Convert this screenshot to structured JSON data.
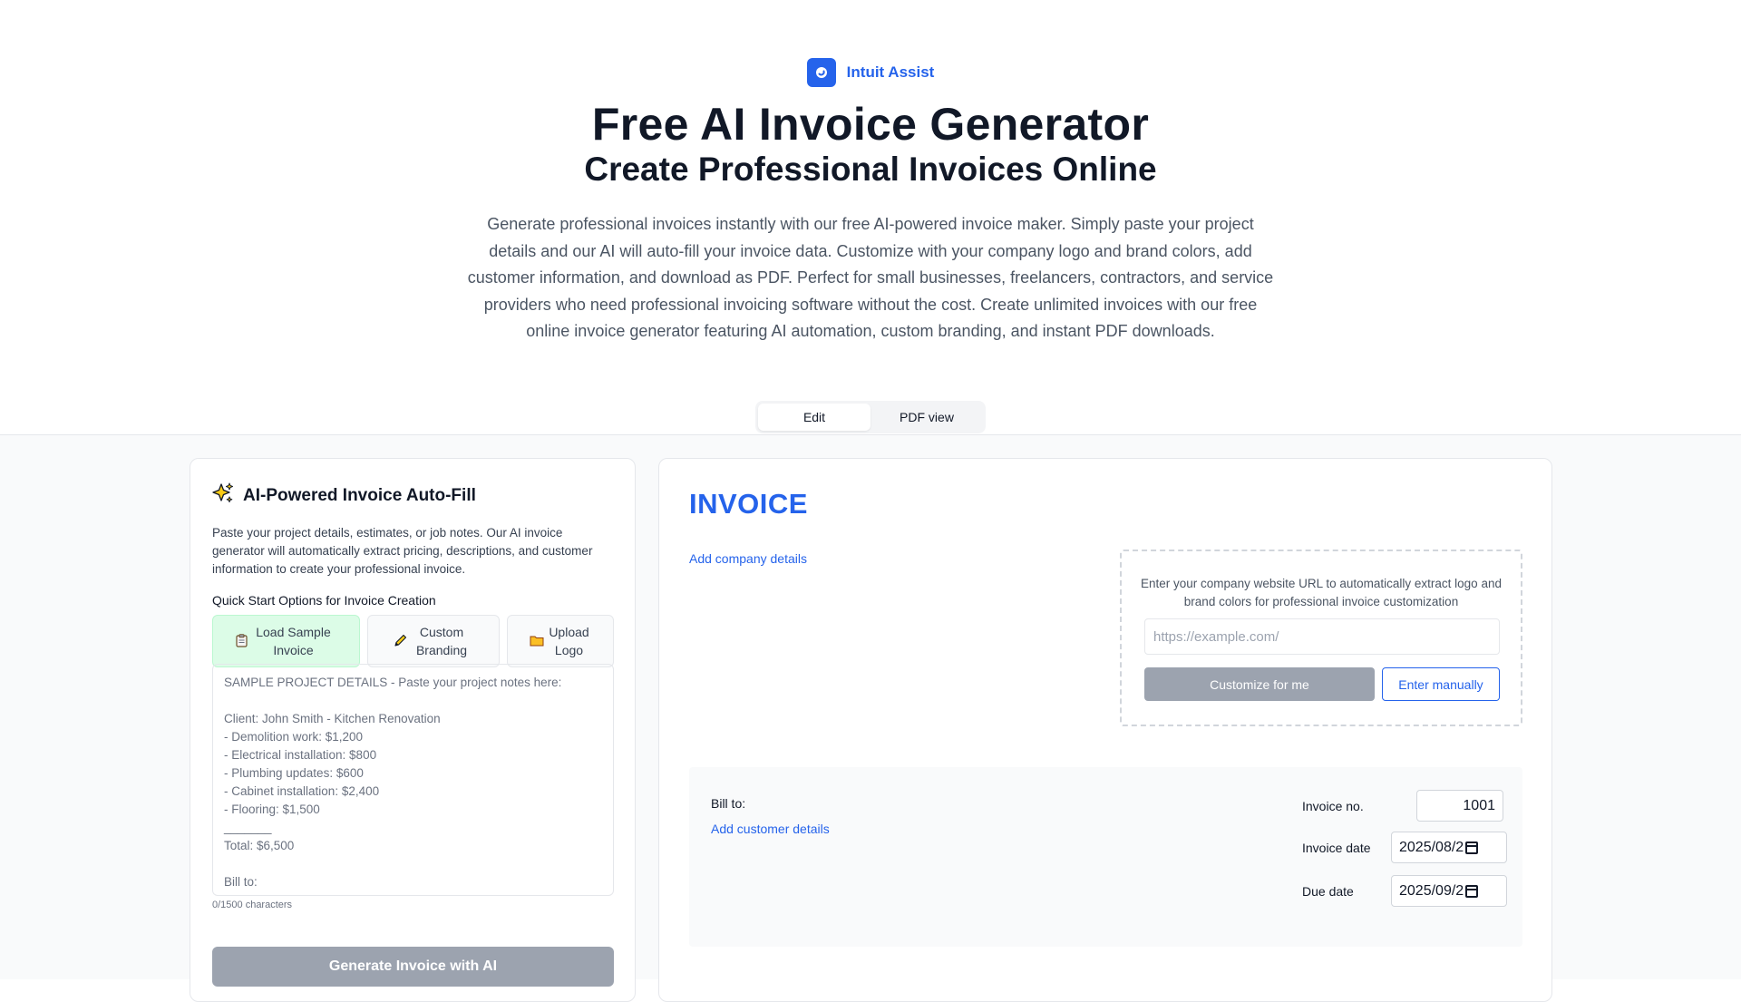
{
  "brand": {
    "name": "Intuit Assist",
    "color": "#2563eb"
  },
  "hero": {
    "title": "Free AI Invoice Generator",
    "subtitle": "Create Professional Invoices Online",
    "description": "Generate professional invoices instantly with our free AI-powered invoice maker. Simply paste your project details and our AI will auto-fill your invoice data. Customize with your company logo and brand colors, add customer information, and download as PDF. Perfect for small businesses, freelancers, contractors, and service providers who need professional invoicing software without the cost. Create unlimited invoices with our free online invoice generator featuring AI automation, custom branding, and instant PDF downloads."
  },
  "view_tabs": [
    {
      "label": "Edit",
      "active": true
    },
    {
      "label": "PDF view",
      "active": false
    }
  ],
  "ai_panel": {
    "title": "AI-Powered Invoice Auto-Fill",
    "description": "Paste your project details, estimates, or job notes. Our AI invoice generator will automatically extract pricing, descriptions, and customer information to create your professional invoice.",
    "quick_start_label": "Quick Start Options for Invoice Creation",
    "quick_start_buttons": [
      {
        "label": "Load Sample Invoice",
        "icon": "clipboard-icon"
      },
      {
        "label": "Custom Branding",
        "icon": "pencil-icon"
      },
      {
        "label": "Upload Logo",
        "icon": "folder-icon"
      }
    ],
    "notes_placeholder": "SAMPLE PROJECT DETAILS - Paste your project notes here:\n\nClient: John Smith - Kitchen Renovation\n- Demolition work: $1,200\n- Electrical installation: $800\n- Plumbing updates: $600\n- Cabinet installation: $2,400\n- Flooring: $1,500\n_______\nTotal: $6,500\n\nBill to:\nJohn Smith",
    "char_counter": "0/1500 characters",
    "generate_button": "Generate Invoice with AI"
  },
  "invoice": {
    "heading": "INVOICE",
    "add_company_link": "Add company details",
    "url_help": "Enter your company website URL to automatically extract logo and brand colors for professional invoice customization",
    "url_placeholder": "https://example.com/",
    "customize_button": "Customize for me",
    "manual_button": "Enter manually",
    "bill_to_label": "Bill to:",
    "add_customer_link": "Add customer details",
    "invoice_no_label": "Invoice no.",
    "invoice_no_value": "1001",
    "invoice_date_label": "Invoice date",
    "invoice_date_value": "2025/08/2",
    "due_date_label": "Due date",
    "due_date_value": "2025/09/2"
  }
}
